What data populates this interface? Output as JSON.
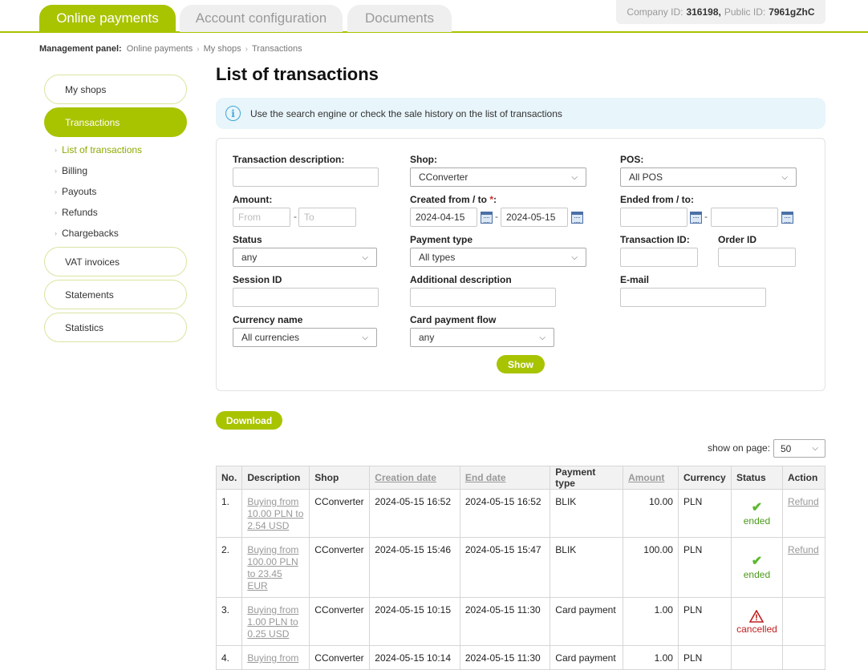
{
  "top_tabs": [
    {
      "label": "Online payments",
      "active": true
    },
    {
      "label": "Account configuration",
      "active": false
    },
    {
      "label": "Documents",
      "active": false
    }
  ],
  "company": {
    "company_label": "Company ID:",
    "company_id": "316198,",
    "public_label": "Public ID:",
    "public_id": "7961gZhC"
  },
  "breadcrumb": {
    "label": "Management panel:",
    "items": [
      "Online payments",
      "My shops",
      "Transactions"
    ],
    "separator": "›"
  },
  "sidebar": {
    "items": [
      {
        "label": "My shops"
      },
      {
        "label": "Transactions"
      },
      {
        "label": "VAT invoices"
      },
      {
        "label": "Statements"
      },
      {
        "label": "Statistics"
      }
    ],
    "subitems": [
      {
        "label": "List of transactions"
      },
      {
        "label": "Billing"
      },
      {
        "label": "Payouts"
      },
      {
        "label": "Refunds"
      },
      {
        "label": "Chargebacks"
      }
    ],
    "bullet": "›"
  },
  "page_title": "List of transactions",
  "info_text": "Use the search engine or check the sale history on the list of transactions",
  "info_icon": "i",
  "filters": {
    "transaction_description": {
      "label": "Transaction description:",
      "value": ""
    },
    "shop": {
      "label": "Shop:",
      "value": "CConverter"
    },
    "pos": {
      "label": "POS:",
      "value": "All POS"
    },
    "amount": {
      "label": "Amount:",
      "from_placeholder": "From",
      "to_placeholder": "To"
    },
    "created": {
      "label": "Created from / to ",
      "required_mark": "*",
      "colon": ":",
      "from": "2024-04-15",
      "to": "2024-05-15"
    },
    "ended": {
      "label": "Ended from / to:",
      "from": "",
      "to": ""
    },
    "status": {
      "label": "Status",
      "value": "any"
    },
    "payment_type": {
      "label": "Payment type",
      "value": "All types"
    },
    "transaction_id": {
      "label": "Transaction ID:",
      "value": ""
    },
    "order_id": {
      "label": "Order ID",
      "value": ""
    },
    "session_id": {
      "label": "Session ID",
      "value": ""
    },
    "additional_description": {
      "label": "Additional description",
      "value": ""
    },
    "email": {
      "label": "E-mail",
      "value": ""
    },
    "currency_name": {
      "label": "Currency name",
      "value": "All currencies"
    },
    "card_payment_flow": {
      "label": "Card payment flow",
      "value": "any"
    },
    "dash": "-",
    "show_button": "Show"
  },
  "download_button": "Download",
  "show_on_page": {
    "label": "show on page:",
    "value": "50"
  },
  "table": {
    "headers": [
      "No.",
      "Description",
      "Shop",
      "Creation date",
      "End date",
      "Payment type",
      "Amount",
      "Currency",
      "Status",
      "Action"
    ],
    "rows": [
      {
        "no": "1.",
        "description_lines": [
          "Buying from",
          "10.00 PLN to",
          "2.54 USD"
        ],
        "shop": "CConverter",
        "created": "2024-05-15 16:52",
        "ended": "2024-05-15 16:52",
        "payment_type": "BLIK",
        "amount": "10.00",
        "currency": "PLN",
        "status": "ended",
        "action": "Refund"
      },
      {
        "no": "2.",
        "description_lines": [
          "Buying from",
          "100.00 PLN",
          "to 23.45",
          "EUR"
        ],
        "shop": "CConverter",
        "created": "2024-05-15 15:46",
        "ended": "2024-05-15 15:47",
        "payment_type": "BLIK",
        "amount": "100.00",
        "currency": "PLN",
        "status": "ended",
        "action": "Refund"
      },
      {
        "no": "3.",
        "description_lines": [
          "Buying from",
          "1.00 PLN to",
          "0.25 USD"
        ],
        "shop": "CConverter",
        "created": "2024-05-15 10:15",
        "ended": "2024-05-15 11:30",
        "payment_type": "Card payment",
        "amount": "1.00",
        "currency": "PLN",
        "status": "cancelled",
        "action": ""
      },
      {
        "no": "4.",
        "description_lines": [
          "Buying from"
        ],
        "shop": "CConverter",
        "created": "2024-05-15 10:14",
        "ended": "2024-05-15 11:30",
        "payment_type": "Card payment",
        "amount": "1.00",
        "currency": "PLN",
        "status": "",
        "action": ""
      }
    ]
  },
  "icons": {
    "chevron": "chevron-down-icon",
    "calendar": "calendar-icon",
    "check": "check-icon",
    "warning": "warning-icon",
    "info": "info-icon"
  },
  "colors": {
    "accent": "#a8c300",
    "info_bg": "#e8f5fb",
    "ended": "#4a9a1a",
    "cancelled": "#c02020"
  }
}
